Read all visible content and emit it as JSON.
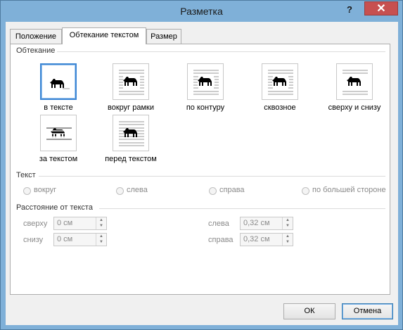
{
  "window": {
    "title": "Разметка",
    "help": "?",
    "close": "✕"
  },
  "tabs": [
    {
      "label": "Положение"
    },
    {
      "label": "Обтекание текстом"
    },
    {
      "label": "Размер"
    }
  ],
  "wrapping": {
    "title": "Обтекание",
    "options": [
      {
        "label": "в тексте",
        "selected": true
      },
      {
        "label": "вокруг рамки"
      },
      {
        "label": "по контуру"
      },
      {
        "label": "сквозное"
      },
      {
        "label": "сверху и снизу"
      },
      {
        "label": "за текстом"
      },
      {
        "label": "перед текстом"
      }
    ]
  },
  "text_group": {
    "title": "Текст",
    "options": [
      "вокруг",
      "слева",
      "справа",
      "по большей стороне"
    ]
  },
  "distance": {
    "title": "Расстояние от текста",
    "top_label": "сверху",
    "top_value": "0 см",
    "bottom_label": "снизу",
    "bottom_value": "0 см",
    "left_label": "слева",
    "left_value": "0,32 см",
    "right_label": "справа",
    "right_value": "0,32 см"
  },
  "buttons": {
    "ok": "ОК",
    "cancel": "Отмена"
  },
  "colors": {
    "accent": "#3c86d4",
    "title_bar": "#7fb0d8",
    "close": "#c75050"
  }
}
